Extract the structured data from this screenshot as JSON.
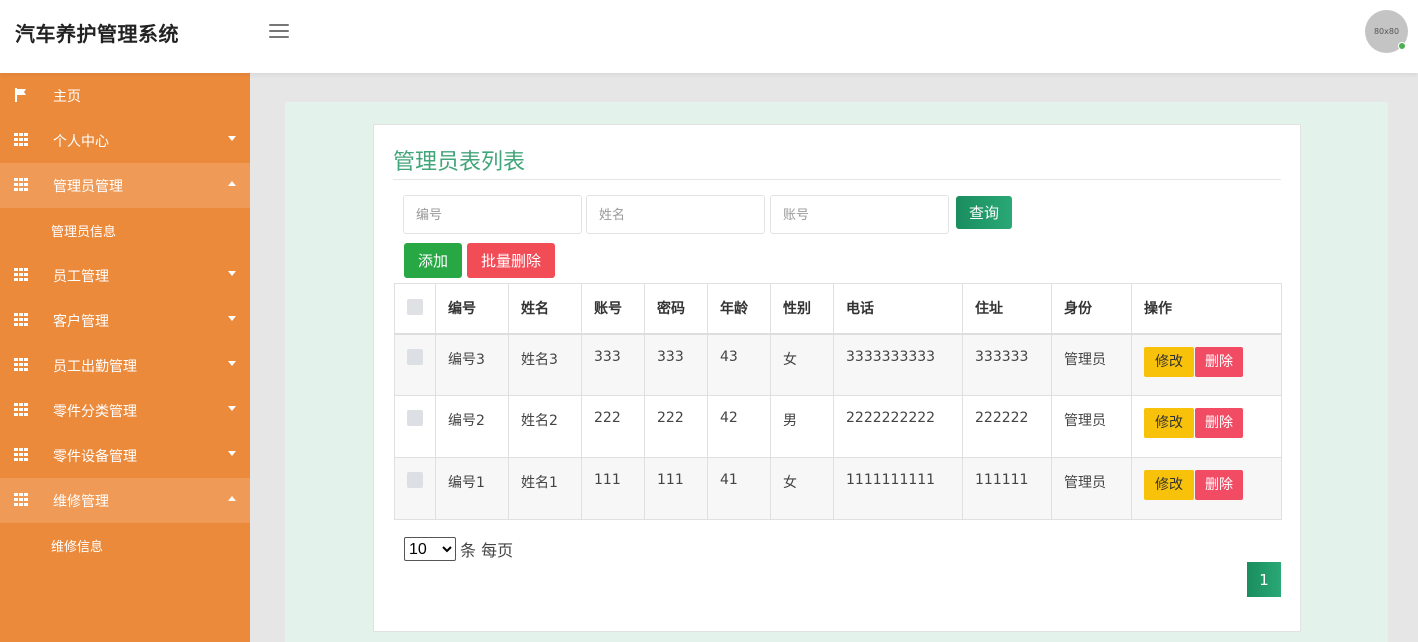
{
  "app": {
    "title": "汽车养护管理系统",
    "avatar_text": "80x80"
  },
  "sidebar": {
    "items": [
      {
        "label": "主页",
        "icon": "flag-icon",
        "expanded": false,
        "has_caret": false
      },
      {
        "label": "个人中心",
        "icon": "grid-icon",
        "expanded": false,
        "has_caret": true
      },
      {
        "label": "管理员管理",
        "icon": "grid-icon",
        "expanded": true,
        "has_caret": true,
        "sub": "管理员信息"
      },
      {
        "label": "员工管理",
        "icon": "grid-icon",
        "expanded": false,
        "has_caret": true
      },
      {
        "label": "客户管理",
        "icon": "grid-icon",
        "expanded": false,
        "has_caret": true
      },
      {
        "label": "员工出勤管理",
        "icon": "grid-icon",
        "expanded": false,
        "has_caret": true
      },
      {
        "label": "零件分类管理",
        "icon": "grid-icon",
        "expanded": false,
        "has_caret": true
      },
      {
        "label": "零件设备管理",
        "icon": "grid-icon",
        "expanded": false,
        "has_caret": true
      },
      {
        "label": "维修管理",
        "icon": "grid-icon",
        "expanded": true,
        "has_caret": true,
        "sub": "维修信息"
      }
    ]
  },
  "main": {
    "title": "管理员表列表",
    "search": {
      "id_placeholder": "编号",
      "name_placeholder": "姓名",
      "account_placeholder": "账号",
      "query_label": "查询"
    },
    "actions": {
      "add_label": "添加",
      "batch_delete_label": "批量删除"
    },
    "table": {
      "columns": [
        "编号",
        "姓名",
        "账号",
        "密码",
        "年龄",
        "性别",
        "电话",
        "住址",
        "身份",
        "操作"
      ],
      "rows": [
        [
          "编号3",
          "姓名3",
          "333",
          "333",
          "43",
          "女",
          "3333333333",
          "333333",
          "管理员"
        ],
        [
          "编号2",
          "姓名2",
          "222",
          "222",
          "42",
          "男",
          "2222222222",
          "222222",
          "管理员"
        ],
        [
          "编号1",
          "姓名1",
          "111",
          "111",
          "41",
          "女",
          "1111111111",
          "111111",
          "管理员"
        ]
      ],
      "edit_label": "修改",
      "delete_label": "删除"
    },
    "pagination": {
      "page_size": "10",
      "page_size_suffix": "条 每页",
      "current_page": "1"
    }
  },
  "colors": {
    "sidebar": "#ec8a3c",
    "accent_green": "#1a8d5f",
    "title_green": "#43a57a",
    "danger": "#f24c57",
    "warning": "#f8c20a"
  }
}
